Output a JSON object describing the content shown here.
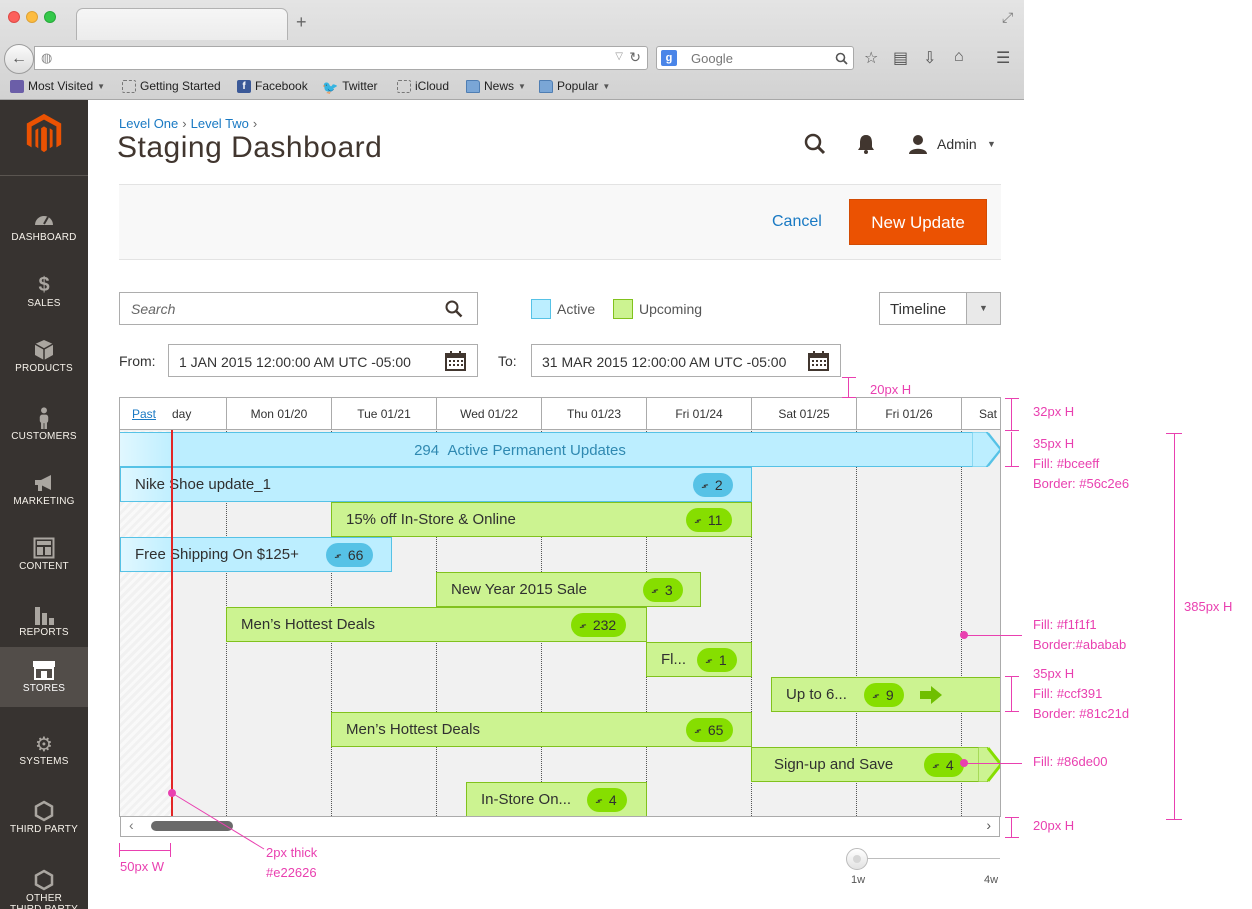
{
  "browser": {
    "search_placeholder": "Google",
    "bookmarks": [
      "Most Visited",
      "Getting Started",
      "Facebook",
      "Twitter",
      "iCloud",
      "News",
      "Popular"
    ]
  },
  "sidebar": {
    "items": [
      {
        "label": "DASHBOARD",
        "icon": "gauge-icon"
      },
      {
        "label": "SALES",
        "icon": "dollar-icon"
      },
      {
        "label": "PRODUCTS",
        "icon": "box-icon"
      },
      {
        "label": "CUSTOMERS",
        "icon": "person-icon"
      },
      {
        "label": "MARKETING",
        "icon": "megaphone-icon"
      },
      {
        "label": "CONTENT",
        "icon": "layout-icon"
      },
      {
        "label": "REPORTS",
        "icon": "bar-chart-icon"
      },
      {
        "label": "STORES",
        "icon": "storefront-icon"
      },
      {
        "label": "SYSTEMS",
        "icon": "gear-icon"
      },
      {
        "label": "THIRD PARTY",
        "icon": "hexagon-icon"
      },
      {
        "label": "OTHER THIRD PARTY",
        "icon": "hexagon-icon"
      }
    ],
    "active": "STORES"
  },
  "breadcrumb": {
    "level1": "Level One",
    "level2": "Level Two"
  },
  "page_title": "Staging Dashboard",
  "header": {
    "user": "Admin"
  },
  "actions": {
    "cancel": "Cancel",
    "new_update": "New Update"
  },
  "filters": {
    "search_placeholder": "Search",
    "legend_active": "Active",
    "legend_upcoming": "Upcoming",
    "view_mode": "Timeline",
    "from_label": "From:",
    "from_value": "1 JAN 2015 12:00:00 AM UTC -05:00",
    "to_label": "To:",
    "to_value": "31 MAR 2015 12:00:00 AM UTC -05:00"
  },
  "timeline": {
    "past_label": "Past",
    "past_day_partial": "day",
    "days": [
      "Mon 01/20",
      "Tue 01/21",
      "Wed 01/22",
      "Thu 01/23",
      "Fri 01/24",
      "Sat 01/25",
      "Fri 01/26",
      "Sat"
    ],
    "permanent": {
      "count": "294",
      "label": "Active Permanent Updates"
    },
    "updates": [
      {
        "name": "Nike Shoe update_1",
        "count": "2",
        "status": "active"
      },
      {
        "name": "15% off In-Store & Online",
        "count": "11",
        "status": "upcoming"
      },
      {
        "name": "Free Shipping On $125+",
        "count": "66",
        "status": "active"
      },
      {
        "name": "New Year 2015 Sale",
        "count": "3",
        "status": "upcoming"
      },
      {
        "name": "Men’s Hottest Deals",
        "count": "232",
        "status": "upcoming"
      },
      {
        "name": "Fl...",
        "count": "1",
        "status": "upcoming"
      },
      {
        "name": "Up to 6...",
        "count": "9",
        "status": "upcoming"
      },
      {
        "name": "Men’s Hottest Deals",
        "count": "65",
        "status": "upcoming"
      },
      {
        "name": "Sign-up and Save",
        "count": "4",
        "status": "upcoming"
      },
      {
        "name": "In-Store On...",
        "count": "4",
        "status": "upcoming"
      }
    ],
    "zoom_min": "1w",
    "zoom_max": "4w"
  },
  "annotations": {
    "gap_20_top": "20px H",
    "header_32": "32px H",
    "perm_35": "35px H",
    "perm_fill": "Fill: #bceeff",
    "perm_border": "Border: #56c2e6",
    "grid_fill": "Fill: #f1f1f1",
    "grid_border": "Border:#ababab",
    "total_385": "385px H",
    "bar_35": "35px H",
    "bar_fill": "Fill: #ccf391",
    "bar_border": "Border: #81c21d",
    "arrow_fill": "Fill: #86de00",
    "scroll_20": "20px H",
    "past_width": "50px W",
    "line_thick": "2px thick",
    "line_color": "#e22626"
  },
  "colors": {
    "accent": "#eb5202",
    "link": "#1979c3",
    "active_fill": "#bceeff",
    "active_border": "#56c2e6",
    "upcoming_fill": "#ccf391",
    "upcoming_border": "#81c21d",
    "pill_fill": "#86de00",
    "grid_fill": "#f1f1f1",
    "grid_border": "#ababab",
    "current_line": "#e22626",
    "annotation": "#e940b0"
  }
}
